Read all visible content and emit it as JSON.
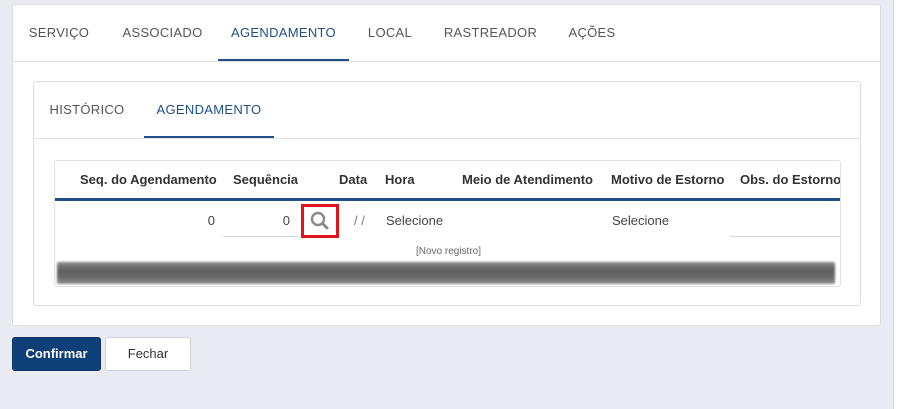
{
  "tabs": [
    {
      "label": "SERVIÇO",
      "active": false
    },
    {
      "label": "ASSOCIADO",
      "active": false
    },
    {
      "label": "AGENDAMENTO",
      "active": true
    },
    {
      "label": "LOCAL",
      "active": false
    },
    {
      "label": "RASTREADOR",
      "active": false
    },
    {
      "label": "AÇÕES",
      "active": false
    }
  ],
  "subtabs": [
    {
      "label": "HISTÓRICO",
      "active": false
    },
    {
      "label": "AGENDAMENTO",
      "active": true
    }
  ],
  "grid": {
    "columns": [
      "Seq. do Agendamento",
      "Sequência",
      "Data",
      "Hora",
      "Meio de Atendimento",
      "Motivo de Estorno",
      "Obs. do Estorno"
    ],
    "row": {
      "seq_agendamento": "0",
      "sequencia": "0",
      "data": "/ /",
      "hora": "Selecione",
      "motivo_estorno": "Selecione"
    },
    "new_record": "[Novo registro]"
  },
  "buttons": {
    "confirm": "Confirmar",
    "close": "Fechar"
  },
  "colors": {
    "accent": "#1f4f86",
    "primary_button": "#0f3f77",
    "highlight": "#e0141a"
  }
}
